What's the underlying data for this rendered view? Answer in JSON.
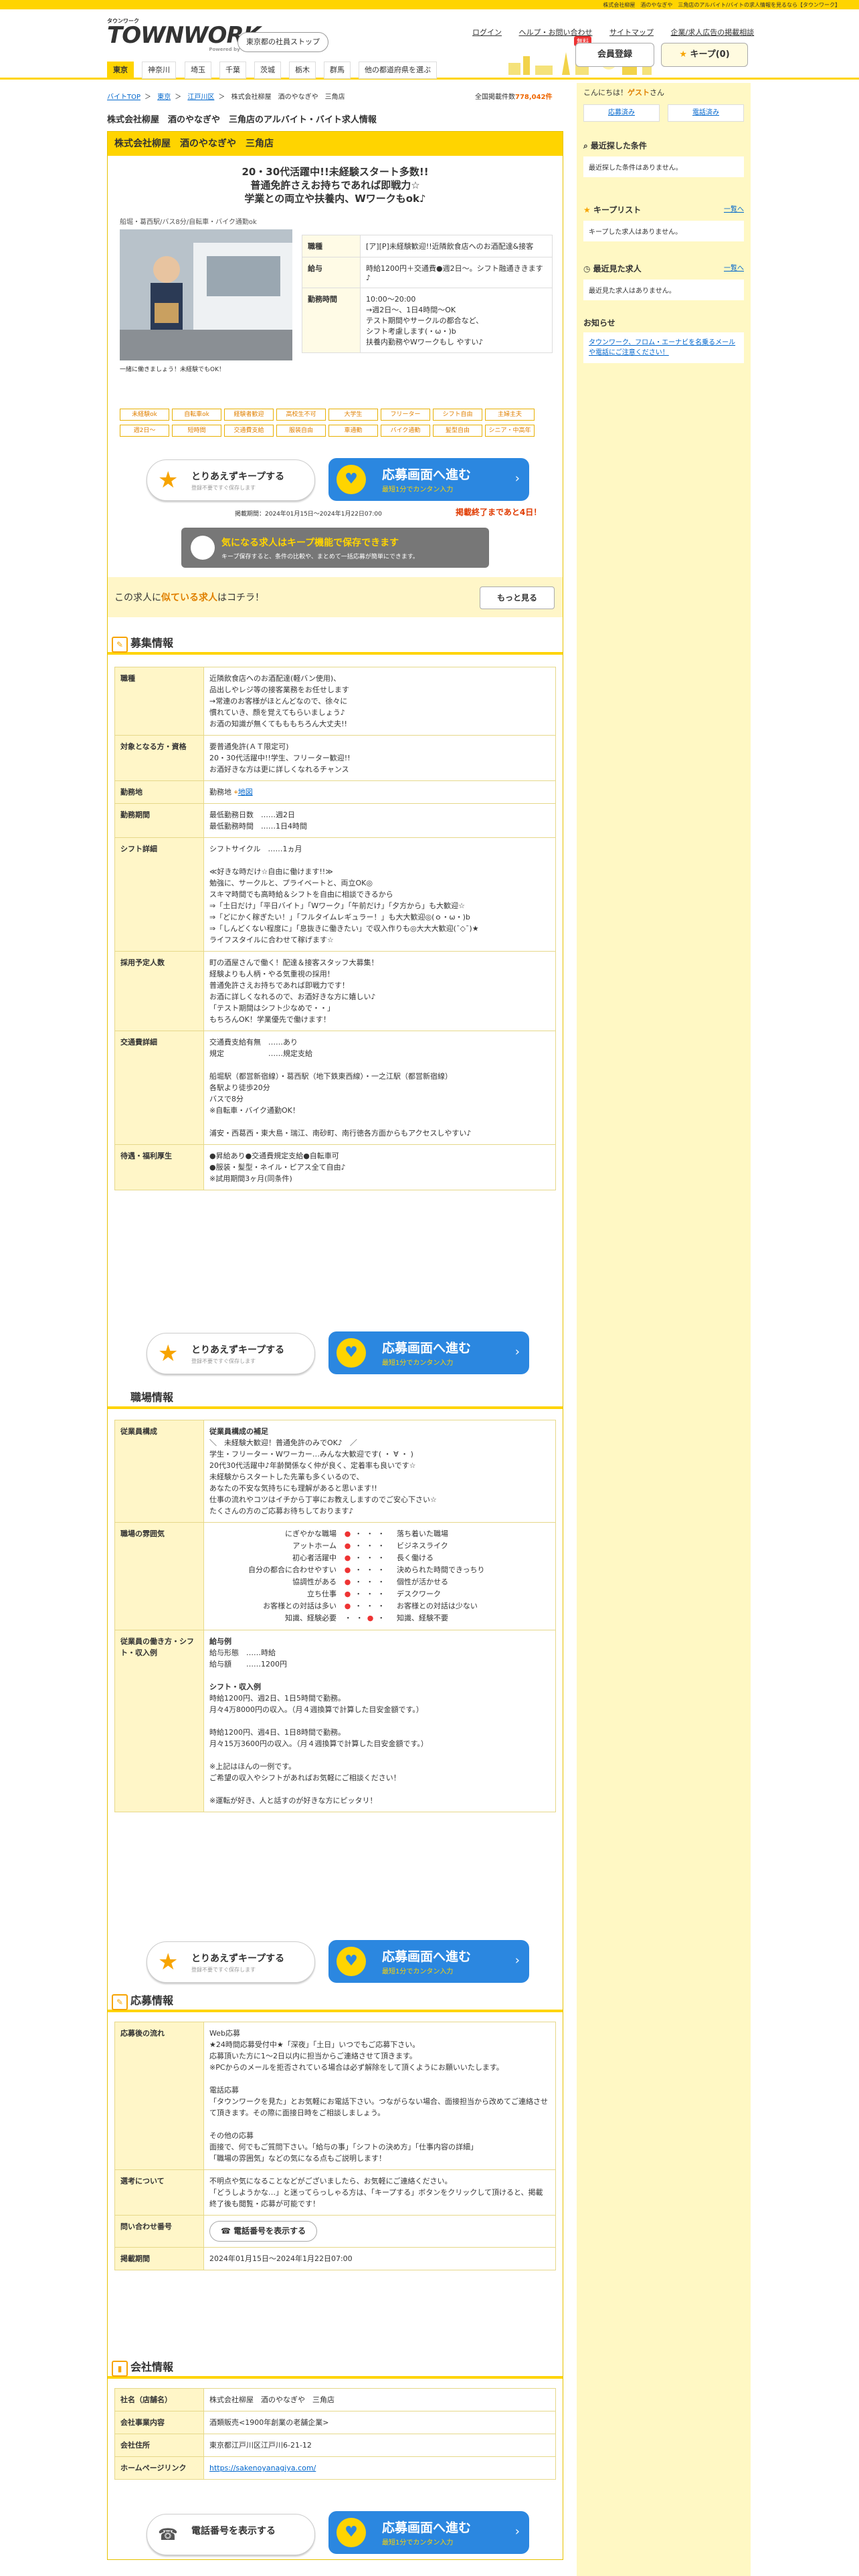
{
  "topbar": {
    "text": "株式会社柳屋　酒のやなぎや　三角店のアルバイト/バイトの求人情報を見るなら【タウンワーク】"
  },
  "header": {
    "logo_small": "タウンワーク",
    "logo_big": "TOWNWORK",
    "logo_sub": "Powered by マイナビ",
    "company_top": "東京都の社員ストップ",
    "links": [
      "ログイン",
      "ヘルプ・お問い合わせ",
      "サイトマップ",
      "企業/求人広告の掲載相談"
    ],
    "register_badge": "無料",
    "register": "会員登録",
    "keep": "キープ(0)"
  },
  "nav": [
    "東京",
    "神奈川",
    "埼玉",
    "千葉",
    "茨城",
    "栃木",
    "群馬",
    "他の都道府県を選ぶ"
  ],
  "breadcrumb": [
    "バイトTOP",
    "東京",
    "江戸川区",
    "株式会社柳屋　酒のやなぎや　三角店"
  ],
  "total": {
    "label": "全国掲載件数",
    "value": "778,042件"
  },
  "page_title": "株式会社柳屋　酒のやなぎや　三角店のアルバイト・バイト求人情報",
  "job": {
    "company": "株式会社柳屋　酒のやなぎや　三角店",
    "catch1": "20・30代活躍中!!未経験スタート多数!!",
    "catch2": "普通免許さえお持ちであれば即戦力☆",
    "catch3": "学業との両立や扶養内、Wワークもok♪",
    "sub_catch": "船堀・葛西駅/バス8分/自転車・バイク通勤ok",
    "photo_caption": "一緒に働きましょう！未経験でもOK！",
    "info": [
      {
        "th": "職種",
        "td": "[ア][P]未経験歓迎!!近隣飲食店へのお酒配達&接客"
      },
      {
        "th": "給与",
        "td": "時給1200円＋交通費●週2日〜。シフト融通ききます♪"
      },
      {
        "th": "勤務時間",
        "td": "10:00〜20:00\n→週2日〜、1日4時間〜OK\nテスト期間やサークルの都合など、\nシフト考慮します(・ω・)b\n扶養内勤務やWワークもし やすい♪"
      }
    ],
    "tags": [
      "未経験ok",
      "自転車ok",
      "経験者歓迎",
      "高校生不可",
      "大学生",
      "フリーター",
      "シフト自由",
      "主婦主夫",
      "週2日〜",
      "短時間",
      "交通費支給",
      "服装自由",
      "車通勤",
      "バイク通勤",
      "髪型自由",
      "シニア・中高年"
    ],
    "keep_btn": {
      "t1": "とりあえずキープする",
      "t2": "登録不要ですぐ保存します"
    },
    "apply_btn": {
      "icon": "♥",
      "t1": "応募画面へ進む",
      "t2": "最短1分でカンタン入力",
      "arrow": "›"
    },
    "period": "掲載期間：2024年01月15日〜2024年1月22日07:00",
    "deadline": "掲載終了まであと4日！",
    "keep_promo": {
      "t1": "気になる求人はキープ機能で保存できます",
      "t2": "キープ保存すると、条件の比較や、まとめて一括応募が簡単にできます。"
    },
    "similar": {
      "pre": "この求人に",
      "em": "似ている求人",
      "post": "はコチラ！",
      "more": "もっと見る"
    }
  },
  "recruit": {
    "title": "募集情報",
    "rows": [
      {
        "th": "職種",
        "lines": [
          "近隣飲食店へのお酒配達(軽バン使用)、",
          "品出しやレジ等の接客業務をお任せします",
          "→常連のお客様がほとんどなので、徐々に",
          "慣れていき、顔を覚えてもらいましょう♪",
          "お酒の知識が無くてもももちろん大丈夫!!"
        ]
      },
      {
        "th": "対象となる方・資格",
        "lines": [
          "要普通免許(ＡＴ限定可)",
          "20・30代活躍中!!学生、フリーター歓迎!!",
          "お酒好きな方は更に詳しくなれるチャンス"
        ]
      },
      {
        "th": "勤務地",
        "lines": [
          "勤務地"
        ],
        "map": "地図"
      },
      {
        "th": "勤務期間",
        "lines": [
          "最低勤務日数　……週2日",
          "最低勤務時間　……1日4時間"
        ]
      },
      {
        "th": "シフト詳細",
        "lines": [
          "シフトサイクル　……1ヵ月",
          "",
          "≪好きな時だけ☆自由に働けます!!≫",
          "勉強に、サークルと、プライベートと、両立OK◎",
          "スキマ時間でも高時給＆シフトを自由に相談できるから",
          "⇒「土日だけ」「平日バイト」「Wワーク」「午前だけ」「夕方から」も大歓迎☆",
          "⇒「どにかく稼ぎたい！」「フルタイムレギュラー！」も大大歓迎◎(ｏ・ω・)b",
          "⇒「しんどくない程度に」「息抜きに働きたい」で収入作りも◎大大大歓迎(¯◇¯)★",
          "ライフスタイルに合わせて稼げます☆"
        ]
      },
      {
        "th": "採用予定人数",
        "lines": [
          "町の酒屋さんで働く！配達＆接客スタッフ大募集！",
          "経験よりも人柄・やる気重視の採用！",
          "普通免許さえお持ちであれば即戦力です！",
          "お酒に詳しくなれるので、お酒好きな方に嬉しい♪",
          "「テスト期間はシフト少なめで・・」",
          "もちろんOK！学業優先で働けます！"
        ]
      },
      {
        "th": "交通費詳細",
        "lines": [
          "交通費支給有無　……あり",
          "規定　　　　　　……規定支給",
          "",
          "船堀駅（都営新宿線）・葛西駅（地下鉄東西線）・一之江駅（都営新宿線）",
          "各駅より徒歩20分",
          "バスで8分",
          "※自転車・バイク通勤OK！",
          "",
          "浦安・西葛西・東大島・瑞江、南砂町、南行徳各方面からもアクセスしやすい♪"
        ]
      },
      {
        "th": "待遇・福利厚生",
        "lines": [
          "●昇給あり●交通費規定支給●自転車可",
          "●服装・髪型・ネイル・ピアス全て自由♪",
          "※試用期間3ヶ月(同条件)"
        ]
      }
    ]
  },
  "workplace": {
    "title": "職場情報",
    "composition_title": "従業員構成の補足",
    "composition": [
      "＼　未経験大歓迎！普通免許のみでOK♪　／",
      "学生・フリーター・Wワーカー…みんな大歓迎です( ・ ∀ ・ )",
      "20代30代活躍中♪年齢関係なく仲が良く、定着率も良いです☆",
      "未経験からスタートした先輩も多くいるので、",
      "あなたの不安な気持ちにも理解があると思います!!",
      "仕事の流れやコツはイチから丁寧にお教えしますのでご安心下さい☆",
      "たくさんの方のご応募お待ちしております♪"
    ],
    "atmosphere": [
      {
        "l": "にぎやかな職場",
        "r": "落ち着いた職場",
        "pos": 1
      },
      {
        "l": "アットホーム",
        "r": "ビジネスライク",
        "pos": 1
      },
      {
        "l": "初心者活躍中",
        "r": "長く働ける",
        "pos": 1
      },
      {
        "l": "自分の都合に合わせやすい",
        "r": "決められた時間できっちり",
        "pos": 1
      },
      {
        "l": "協調性がある",
        "r": "個性が活かせる",
        "pos": 1
      },
      {
        "l": "立ち仕事",
        "r": "デスクワーク",
        "pos": 1
      },
      {
        "l": "お客様との対話は多い",
        "r": "お客様との対話は少ない",
        "pos": 1
      },
      {
        "l": "知識、経験必要",
        "r": "知識、経験不要",
        "pos": 3
      }
    ],
    "pay_example": [
      "給与例",
      "給与形態　……時給",
      "給与額　　……1200円",
      "",
      "シフト・収入例",
      "時給1200円、週2日、1日5時間で勤務。",
      "月々4万8000円の収入。（月４週換算で計算した目安金額です。）",
      "",
      "時給1200円、週4日、1日8時間で勤務。",
      "月々15万3600円の収入。（月４週換算で計算した目安金額です。）",
      "",
      "※上記はほんの一例です。",
      "ご希望の収入やシフトがあればお気軽にご相談ください！",
      "",
      "※運転が好き、人と話すのが好きな方にピッタリ！"
    ],
    "rows_th": [
      "従業員構成",
      "職場の雰囲気",
      "従業員の働き方・シフト・収入例"
    ]
  },
  "apply": {
    "title": "応募情報",
    "rows": [
      {
        "th": "応募後の流れ",
        "lines": [
          "Web応募",
          "★24時間応募受付中★「深夜」「土日」いつでもご応募下さい。",
          "応募頂いた方に1〜2日以内に担当からご連絡させて頂きます。",
          "※PCからのメールを拒否されている場合は必ず解除をして頂くようにお願いいたします。",
          "",
          "電話応募",
          "「タウンワークを見た」とお気軽にお電話下さい。つながらない場合、面接担当から改めてご連絡させて頂きます。その際に面接日時をご相談しましょう。",
          "",
          "その他の応募",
          "面接で、何でもご質問下さい。「給与の事」「シフトの決め方」「仕事内容の詳細」",
          "「職場の雰囲気」などの気になる点もご説明します！"
        ]
      },
      {
        "th": "選考について",
        "lines": [
          "不明点や気になることなどがございましたら、お気軽にご連絡ください。",
          "「どうしようかな…」と迷ってらっしゃる方は、「キープする」ボタンをクリックして頂けると、掲載終了後も閲覧・応募が可能です！"
        ]
      },
      {
        "th": "問い合わせ番号",
        "btn": "電話番号を表示する"
      },
      {
        "th": "掲載期間",
        "lines": [
          "2024年01月15日〜2024年1月22日07:00"
        ]
      }
    ]
  },
  "company": {
    "title": "会社情報",
    "rows": [
      {
        "th": "社名（店舗名）",
        "v": "株式会社柳屋　酒のやなぎや　三角店"
      },
      {
        "th": "会社事業内容",
        "v": "酒類販売<1900年創業の老舗企業>"
      },
      {
        "th": "会社住所",
        "v": "東京都江戸川区江戸川6-21-12"
      },
      {
        "th": "ホームページリンク",
        "v": "https://sakenoyanagiya.com/"
      }
    ]
  },
  "sidebar": {
    "greet_pre": "こんにちは！",
    "greet_name": "ゲスト",
    "greet_post": "さん",
    "btn1": "応募済み",
    "btn2": "電話済み",
    "recent_cond_h": "最近探した条件",
    "recent_cond": "最近探した条件はありません。",
    "keep_h": "キープリスト",
    "keep_more": "一覧へ",
    "keep_box": "キープした求人はありません。",
    "recent_job_h": "最近見た求人",
    "recent_job_more": "一覧へ",
    "recent_job_box": "最近見た求人はありません。",
    "notice_h": "お知らせ",
    "notice": "タウンワーク、フロム・エーナビを名乗るメール や電話にご注意ください！"
  }
}
